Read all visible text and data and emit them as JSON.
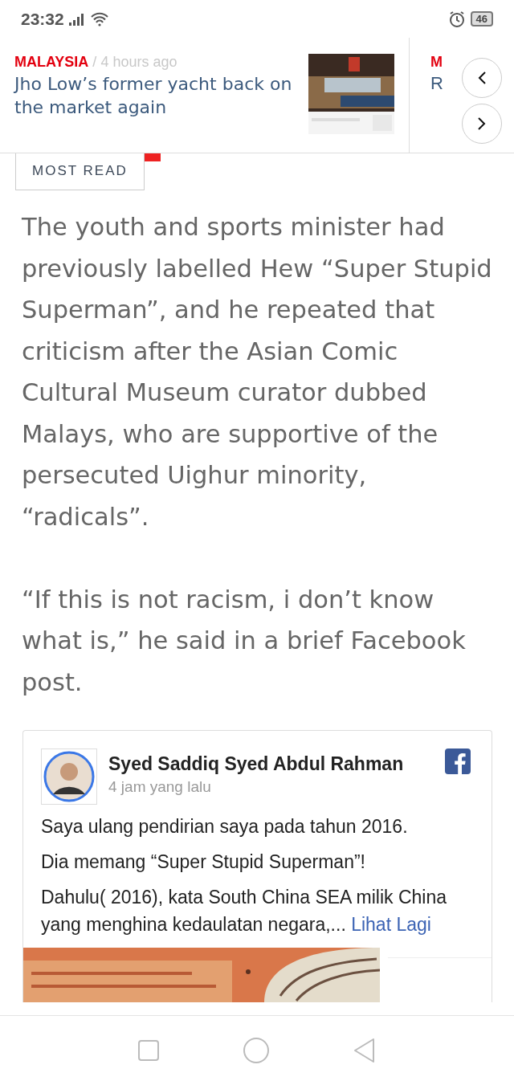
{
  "status_bar": {
    "time": "23:32",
    "battery": "46"
  },
  "top_story": {
    "category": "MALAYSIA",
    "separator": "/",
    "time": "4 hours ago",
    "title": "Jho Low’s former yacht back on the market again"
  },
  "next_story": {
    "category": "M",
    "title": "R"
  },
  "tabs": [
    {
      "label": "MOST READ",
      "selected": true
    }
  ],
  "article": {
    "paragraphs": [
      "The youth and sports minister had previously labelled Hew “Super Stupid Superman”, and he repeated that criticism after the Asian Comic Cultural Museum curator dubbed Malays, who are supportive of the persecuted Uighur minority, “radicals”.",
      "“If this is not racism, i don’t know what is,” he said in a brief Facebook post."
    ]
  },
  "facebook_post": {
    "author": "Syed Saddiq Syed Abdul Rahman",
    "time": "4 jam yang lalu",
    "lines": [
      "Saya ulang pendirian saya pada tahun 2016.",
      "Dia memang “Super Stupid Superman”!",
      "Dahulu( 2016), kata South China SEA milik China yang menghina kedaulatan negara,..."
    ],
    "more_link": "Lihat Lagi"
  }
}
